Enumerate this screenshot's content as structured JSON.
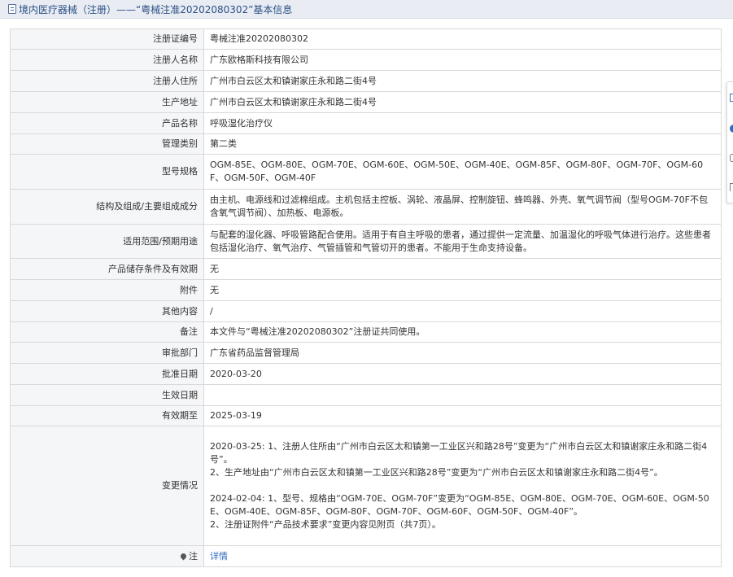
{
  "header": {
    "icon": "document-icon",
    "title": "境内医疗器械（注册）——“粤械注准20202080302”基本信息"
  },
  "rows": {
    "reg_no": {
      "label": "注册证编号",
      "value": "粤械注准20202080302"
    },
    "registrant": {
      "label": "注册人名称",
      "value": "广东欧格斯科技有限公司"
    },
    "registrant_address": {
      "label": "注册人住所",
      "value": "广州市白云区太和镇谢家庄永和路二街4号"
    },
    "production_address": {
      "label": "生产地址",
      "value": "广州市白云区太和镇谢家庄永和路二街4号"
    },
    "product_name": {
      "label": "产品名称",
      "value": "呼吸湿化治疗仪"
    },
    "category": {
      "label": "管理类别",
      "value": "第二类"
    },
    "models": {
      "label": "型号规格",
      "value": "OGM-85E、OGM-80E、OGM-70E、OGM-60E、OGM-50E、OGM-40E、OGM-85F、OGM-80F、OGM-70F、OGM-60F、OGM-50F、OGM-40F"
    },
    "structure": {
      "label": "结构及组成/主要组成成分",
      "value": "由主机、电源线和过滤棉组成。主机包括主控板、涡轮、液晶屏、控制旋钮、蜂鸣器、外壳、氧气调节阀（型号OGM-70F不包含氧气调节阀）、加热板、电源板。"
    },
    "scope": {
      "label": "适用范围/预期用途",
      "value": "与配套的湿化器、呼吸管路配合使用。适用于有自主呼吸的患者，通过提供一定流量、加温湿化的呼吸气体进行治疗。这些患者包括湿化治疗、氧气治疗、气管插管和气管切开的患者。不能用于生命支持设备。"
    },
    "storage": {
      "label": "产品储存条件及有效期",
      "value": "无"
    },
    "attachment": {
      "label": "附件",
      "value": "无"
    },
    "other": {
      "label": "其他内容",
      "value": "/"
    },
    "remarks": {
      "label": "备注",
      "value": "本文件与“粤械注准20202080302”注册证共同使用。"
    },
    "approval_dept": {
      "label": "审批部门",
      "value": "广东省药品监督管理局"
    },
    "approval_date": {
      "label": "批准日期",
      "value": "2020-03-20"
    },
    "effective_date": {
      "label": "生效日期",
      "value": ""
    },
    "expiry_date": {
      "label": "有效期至",
      "value": "2025-03-19"
    },
    "changes": {
      "label": "变更情况",
      "entries": [
        "2020-03-25: 1、注册人住所由“广州市白云区太和镇第一工业区兴和路28号”变更为“广州市白云区太和镇谢家庄永和路二街4号”。",
        "2、生产地址由“广州市白云区太和镇第一工业区兴和路28号”变更为“广州市白云区太和镇谢家庄永和路二街4号”。",
        "2024-02-04: 1、型号、规格由“OGM-70E、OGM-70F”变更为“OGM-85E、OGM-80E、OGM-70E、OGM-60E、OGM-50E、OGM-40E、OGM-85F、OGM-80F、OGM-70F、OGM-60F、OGM-50F、OGM-40F”。",
        "2、注册证附件“产品技术要求”变更内容见附页（共7页）。"
      ]
    },
    "note": {
      "label": "注",
      "icon": "location-pin-icon",
      "link": "详情"
    }
  }
}
